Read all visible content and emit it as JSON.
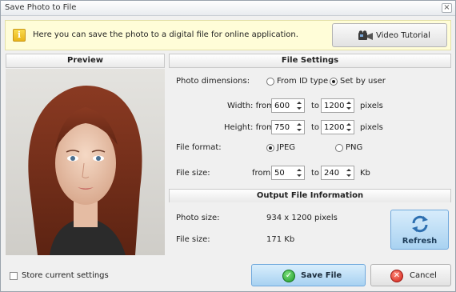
{
  "window": {
    "title": "Save Photo to File",
    "close_glyph": "×"
  },
  "info": {
    "icon_glyph": "i",
    "icon": "info-icon",
    "text": "Here you can save the photo to a digital file for online application.",
    "video_button_label": "Video Tutorial",
    "video_icon": "video-camera-icon"
  },
  "preview": {
    "heading": "Preview"
  },
  "file_settings": {
    "heading": "File Settings",
    "photo_dimensions_label": "Photo dimensions:",
    "option_from_id": "From ID type",
    "option_set_by_user": "Set by user",
    "selected_dimension_option": "Set by user",
    "width_label": "Width: from",
    "width_from": "600",
    "width_to_label": "to",
    "width_to": "1200",
    "width_unit": "pixels",
    "height_label": "Height: from",
    "height_from": "750",
    "height_to_label": "to",
    "height_to": "1200",
    "height_unit": "pixels",
    "file_format_label": "File format:",
    "format_jpeg": "JPEG",
    "format_png": "PNG",
    "selected_format": "JPEG",
    "file_size_label": "File size:",
    "size_from_label": "from",
    "size_from": "50",
    "size_to_label": "to",
    "size_to": "240",
    "size_unit": "Kb"
  },
  "output_info": {
    "heading": "Output File Information",
    "photo_size_label": "Photo size:",
    "photo_size_value": "934 x 1200 pixels",
    "file_size_label": "File size:",
    "file_size_value": "171 Kb",
    "refresh_label": "Refresh",
    "refresh_icon": "refresh-icon"
  },
  "footer": {
    "store_settings_label": "Store current settings",
    "store_settings_checked": false,
    "save_label": "Save File",
    "save_icon": "checkmark-icon",
    "cancel_label": "Cancel",
    "cancel_icon": "cancel-icon"
  },
  "colors": {
    "info_bar_bg": "#fffdd8",
    "accent_button": "#a7d1f1",
    "window_bg": "#f0f0f0"
  }
}
